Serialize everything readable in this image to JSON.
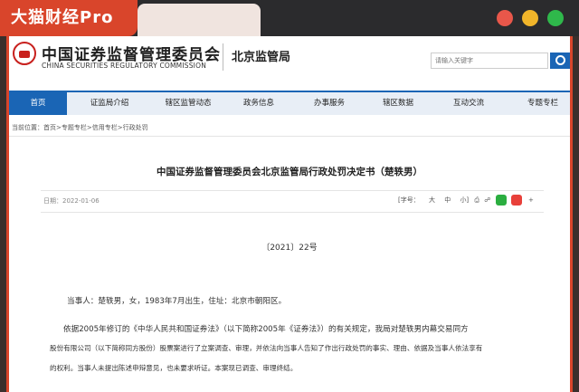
{
  "overlay": {
    "brand": "大猫财经Pro",
    "dots": [
      "#e8574a",
      "#f1b52a",
      "#2fb84b"
    ]
  },
  "header": {
    "logo_cn": "中国证券监督管理委员会",
    "logo_en": "CHINA SECURITIES REGULATORY COMMISSION",
    "bureau": "北京监管局",
    "search_placeholder": "请输入关键字"
  },
  "nav": {
    "items": [
      "首页",
      "证监局介绍",
      "辖区监管动态",
      "政务信息",
      "办事服务",
      "辖区数据",
      "互动交流",
      "专题专栏"
    ],
    "active_index": 0
  },
  "breadcrumb": "当前位置：首页>专题专栏>信用专栏>行政处罚",
  "article": {
    "title": "中国证券监督管理委员会北京监管局行政处罚决定书（楚轶男）",
    "date": "日期：2022-01-06",
    "tools": {
      "font_label": "[字号：",
      "large": "大",
      "medium": "中",
      "small": "小]",
      "plus": "+"
    },
    "doc_no": "〔2021〕22号",
    "paragraphs": [
      "当事人：楚轶男，女，1983年7月出生，住址：北京市朝阳区。",
      "依据2005年修订的《中华人民共和国证券法》（以下简称2005年《证券法》）的有关规定，我局对楚轶男内幕交易同方",
      "股份有限公司（以下简称同方股份）股票案进行了立案调查、审理，并依法向当事人告知了作出行政处罚的事实、理由、依据及当事人依法享有",
      "的权利。当事人未提出陈述申辩意见，也未要求听证。本案现已调查、审理终结。"
    ]
  }
}
